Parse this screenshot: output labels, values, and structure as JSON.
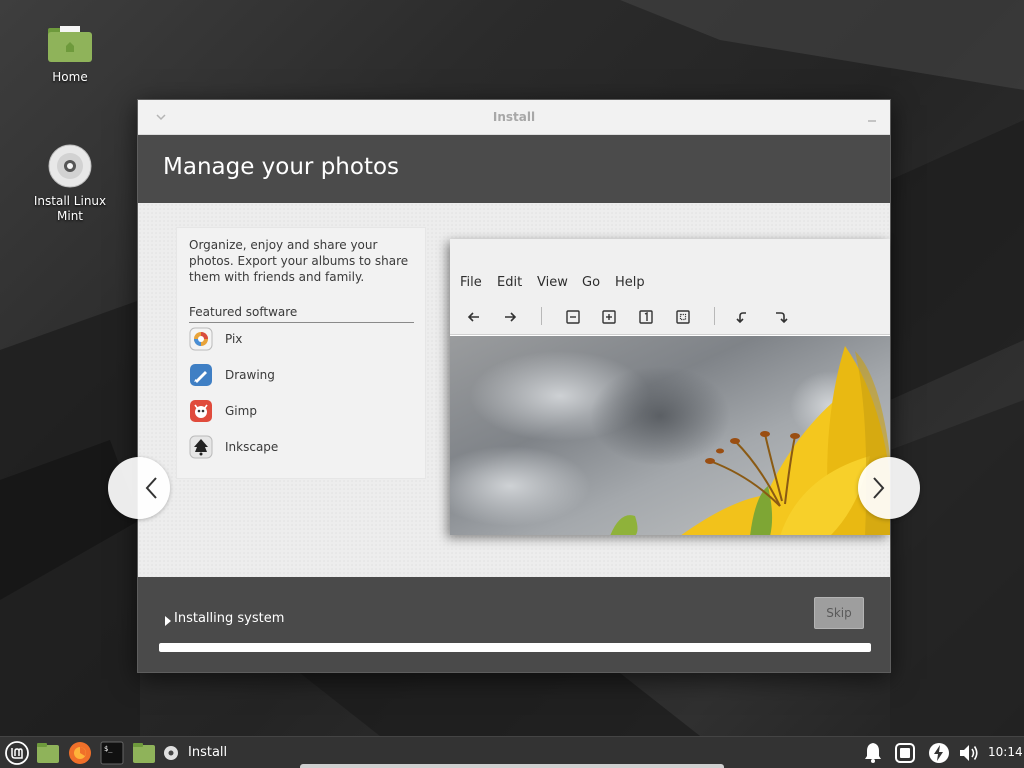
{
  "desktop": {
    "icons": [
      {
        "label": "Home",
        "icon": "folder-home-icon"
      },
      {
        "label": "Install Linux Mint",
        "icon": "disc-icon"
      }
    ]
  },
  "window": {
    "title": "Install",
    "header_title": "Manage your photos",
    "description": "Organize, enjoy and share your photos. Export your albums to share them with friends and family.",
    "featured_title": "Featured software",
    "apps": [
      {
        "label": "Pix",
        "icon": "pix-icon",
        "color": "#f0f0f0"
      },
      {
        "label": "Drawing",
        "icon": "drawing-icon",
        "color": "#3f7fc4"
      },
      {
        "label": "Gimp",
        "icon": "gimp-icon",
        "color": "#e04b3c"
      },
      {
        "label": "Inkscape",
        "icon": "inkscape-icon",
        "color": "#e6e6e6"
      }
    ],
    "preview": {
      "menus": [
        "File",
        "Edit",
        "View",
        "Go",
        "Help"
      ]
    },
    "status_text": "Installing system",
    "skip_label": "Skip",
    "progress": 1.0
  },
  "taskbar": {
    "items": [
      "mint-menu-icon",
      "files-icon",
      "firefox-icon",
      "terminal-icon",
      "folder-icon"
    ],
    "install_label": "Install",
    "tray": [
      "notifications-icon",
      "update-manager-icon",
      "power-icon",
      "volume-icon"
    ],
    "clock": "10:14"
  },
  "colors": {
    "header": "#4b4b4b",
    "content": "#ededed",
    "footer": "#4a4a4a",
    "accent_green": "#8fb35a"
  }
}
